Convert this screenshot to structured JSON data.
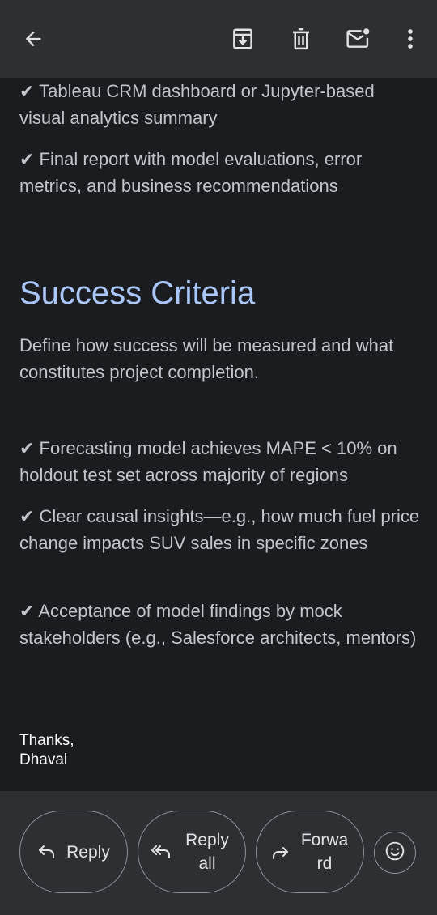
{
  "toolbar": {
    "back_icon": "arrow-left-icon",
    "archive_icon": "archive-icon",
    "delete_icon": "trash-icon",
    "mark_unread_icon": "mail-unread-icon",
    "more_icon": "more-vert-icon"
  },
  "body": {
    "deliverables": [
      "✔ Tableau CRM dashboard or Jupyter-based visual analytics summary",
      "✔ Final report with model evaluations, error metrics, and business recommendations"
    ],
    "success_heading": "Success Criteria",
    "success_intro": "Define how success will be measured and what constitutes project completion.",
    "criteria": [
      "✔ Forecasting model achieves MAPE < 10% on holdout test set across majority of regions",
      "✔ Clear causal insights—e.g., how much fuel price change impacts SUV sales in specific zones",
      "✔ Acceptance of model findings by mock stakeholders (e.g., Salesforce architects, mentors)"
    ],
    "signoff_thanks": "Thanks,",
    "signoff_name": "Dhaval"
  },
  "actions": {
    "reply_label": "Reply",
    "reply_all_label": "Reply all",
    "forward_label": "Forwa rd",
    "emoji_icon": "smiley-icon"
  }
}
